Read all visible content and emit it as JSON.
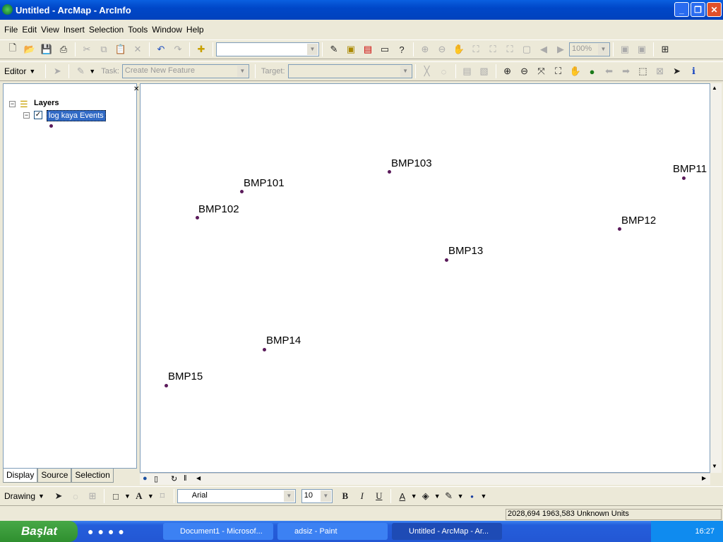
{
  "window": {
    "title": "Untitled - ArcMap - ArcInfo",
    "min": "_",
    "max": "❐",
    "close": "✕"
  },
  "menu": [
    "File",
    "Edit",
    "View",
    "Insert",
    "Selection",
    "Tools",
    "Window",
    "Help"
  ],
  "toolbar": {
    "zoom_value": "100%"
  },
  "editor": {
    "label": "Editor",
    "task_label": "Task:",
    "task_value": "Create New Feature",
    "target_label": "Target:"
  },
  "toc": {
    "root": "Layers",
    "layer": "log kaya Events",
    "tabs": [
      "Display",
      "Source",
      "Selection"
    ]
  },
  "map": {
    "points": [
      {
        "label": "BMP103"
      },
      {
        "label": "BMP101"
      },
      {
        "label": "BMP102"
      },
      {
        "label": "BMP11"
      },
      {
        "label": "BMP12"
      },
      {
        "label": "BMP13"
      },
      {
        "label": "BMP14"
      },
      {
        "label": "BMP15"
      }
    ],
    "point_color": "#5a1a5a"
  },
  "drawing": {
    "label": "Drawing",
    "font": "Arial",
    "size": "10",
    "bold": "B",
    "italic": "I",
    "underline": "U"
  },
  "status": {
    "coords": "2028,694  1963,583 Unknown Units"
  },
  "taskbar": {
    "start": "Başlat",
    "tasks": [
      "Document1 - Microsof...",
      "adsiz - Paint",
      "Untitled - ArcMap - Ar..."
    ],
    "clock": "16:27"
  }
}
